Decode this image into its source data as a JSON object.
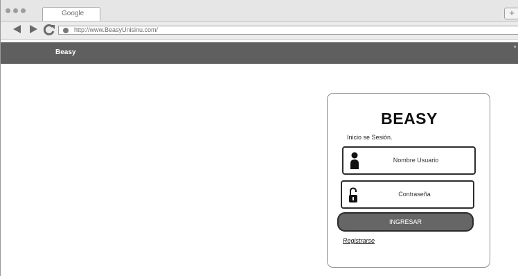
{
  "browser": {
    "tab_title": "Google",
    "new_tab_label": "+",
    "url": "http://www.BeasyUnisinu.com/"
  },
  "appbar": {
    "brand": "Beasy",
    "menu_glyph": "*"
  },
  "login": {
    "title": "BEASY",
    "subtitle": "Inicio se Sesión.",
    "username_placeholder": "Nombre Usuario",
    "password_placeholder": "Contraseña",
    "submit_label": "INGRESAR",
    "register_label": "Registrarse"
  },
  "icons": {
    "user": "user-icon",
    "lock": "lock-icon"
  }
}
